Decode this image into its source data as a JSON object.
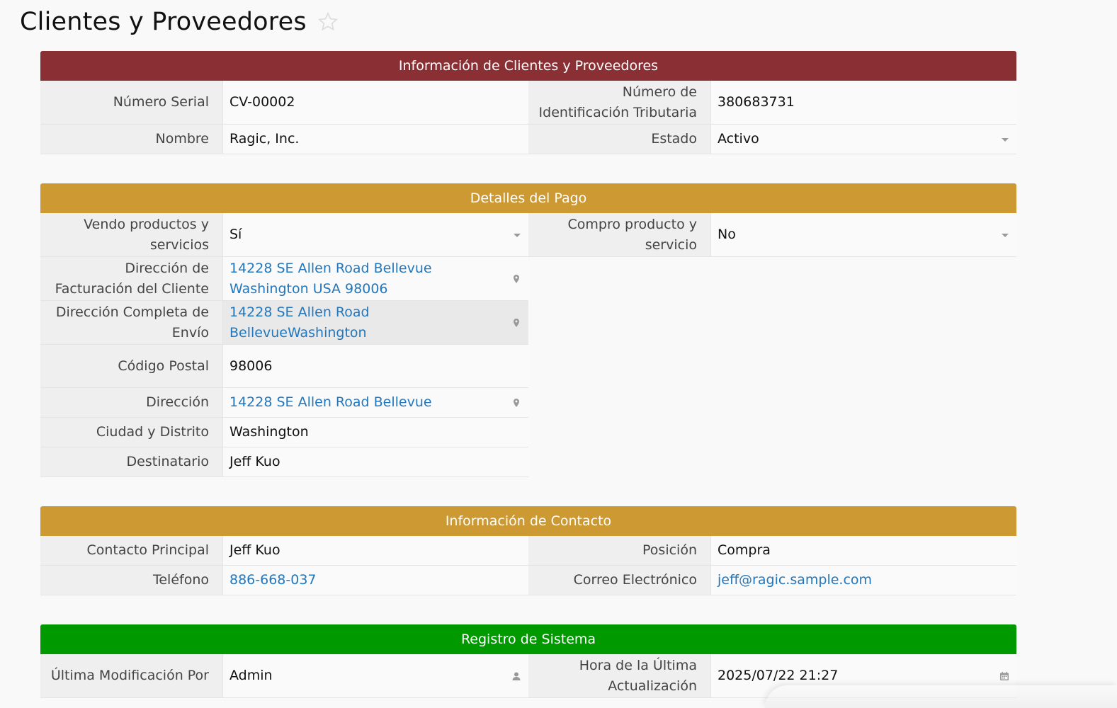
{
  "page": {
    "title": "Clientes y Proveedores"
  },
  "colors": {
    "info_header": "#8a3034",
    "payment_header": "#cc9933",
    "contact_header": "#cc9933",
    "system_header": "#009900",
    "link": "#2377bd"
  },
  "sections": {
    "info": {
      "title": "Información de Clientes y Proveedores",
      "serial_label": "Número Serial",
      "serial_value": "CV-00002",
      "tax_label": "Número de Identificación Tributaria",
      "tax_value": "380683731",
      "name_label": "Nombre",
      "name_value": "Ragic, Inc.",
      "status_label": "Estado",
      "status_value": "Activo"
    },
    "payment": {
      "title": "Detalles del Pago",
      "sell_label": "Vendo productos y servicios",
      "sell_value": "Sí",
      "buy_label": "Compro producto y servicio",
      "buy_value": "No",
      "billing_label": "Dirección de Facturación del Cliente",
      "billing_value": "14228 SE Allen Road Bellevue Washington USA 98006",
      "shipping_label": "Dirección Completa de Envío",
      "shipping_value": "14228 SE Allen Road BellevueWashington",
      "zip_label": "Código Postal",
      "zip_value": "98006",
      "address_label": "Dirección",
      "address_value": "14228 SE Allen Road Bellevue",
      "city_label": "Ciudad y Distrito",
      "city_value": "Washington",
      "recipient_label": "Destinatario",
      "recipient_value": "Jeff Kuo"
    },
    "contact": {
      "title": "Información de Contacto",
      "main_label": "Contacto Principal",
      "main_value": "Jeff Kuo",
      "position_label": "Posición",
      "position_value": "Compra",
      "phone_label": "Teléfono",
      "phone_value": "886-668-037",
      "email_label": "Correo Electrónico",
      "email_value": "jeff@ragic.sample.com"
    },
    "system": {
      "title": "Registro de Sistema",
      "modified_by_label": "Última Modificación Por",
      "modified_by_value": "Admin",
      "updated_label": "Hora de la Última Actualización",
      "updated_value": "2025/07/22 21:27"
    }
  },
  "icons": {
    "favorite": "star-icon",
    "location": "map-pin-icon",
    "dropdown": "caret-down-icon",
    "user": "user-icon",
    "calendar": "calendar-icon"
  }
}
